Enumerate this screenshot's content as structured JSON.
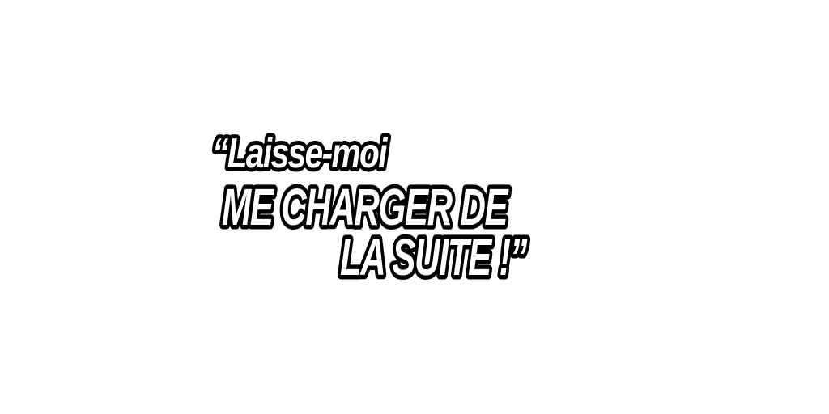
{
  "quote": {
    "line1": "“Laisse-moi",
    "line2": "ME CHARGER DE",
    "line3": "LA SUITE !”"
  },
  "colors": {
    "background": "#ffffff",
    "text_fill": "#ffffff",
    "text_outline": "#000000"
  }
}
